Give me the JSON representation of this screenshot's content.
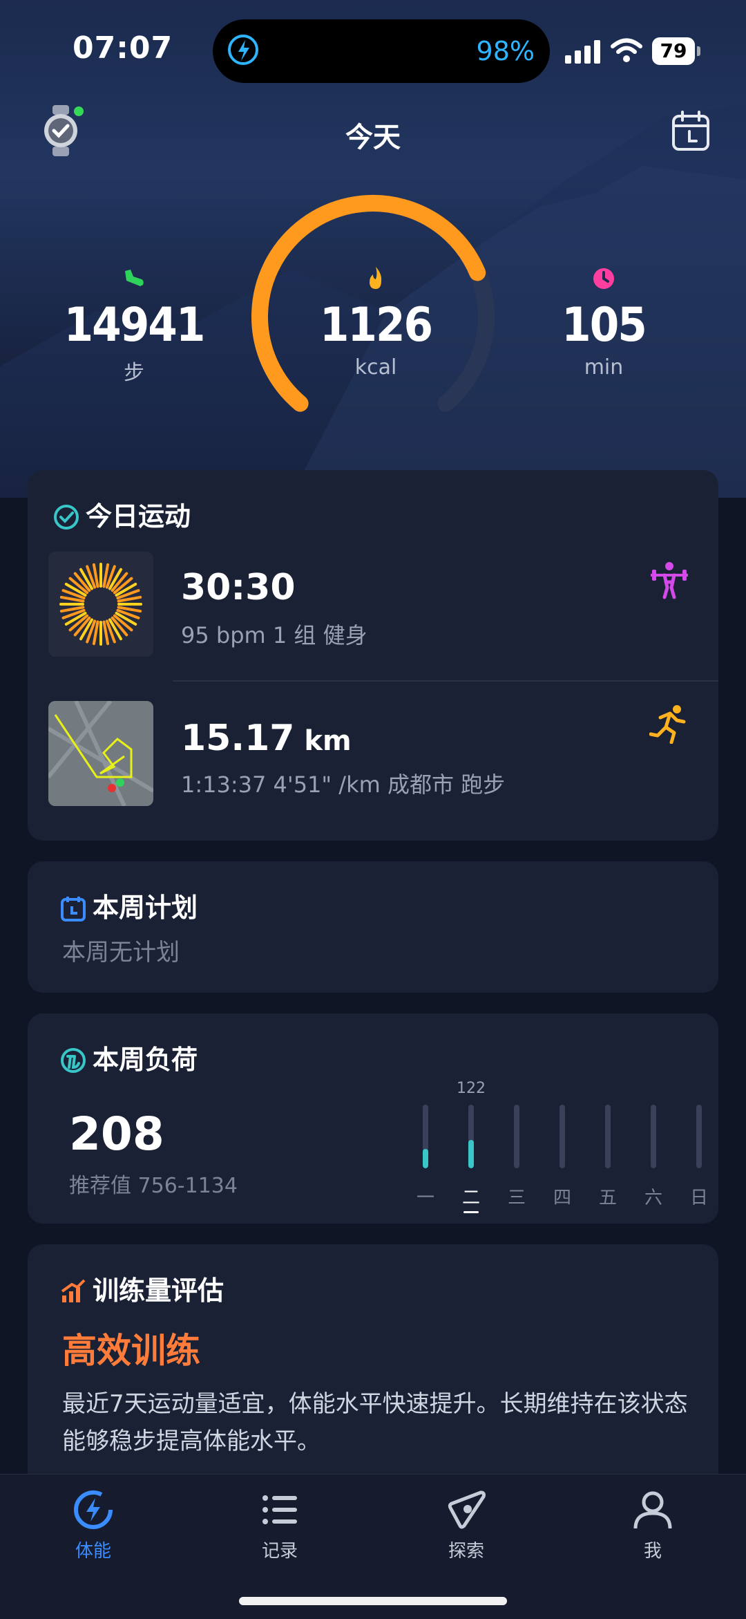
{
  "status_bar": {
    "time": "07:07",
    "battery_percent": "98%",
    "battery_level": "79"
  },
  "header": {
    "title": "今天"
  },
  "summary": {
    "steps": {
      "value": "14941",
      "unit": "步",
      "icon": "shoe-icon",
      "color": "#2fd35c"
    },
    "calories": {
      "value": "1126",
      "unit": "kcal",
      "icon": "flame-icon",
      "color": "#ff9a1f",
      "ring_progress": 0.74
    },
    "minutes": {
      "value": "105",
      "unit": "min",
      "icon": "clock-icon",
      "color": "#ff3fa0"
    }
  },
  "today": {
    "title": "今日运动",
    "activities": [
      {
        "main": "30:30",
        "unit": "",
        "detail": "95 bpm  1 组 健身",
        "icon": "weightlifting-icon"
      },
      {
        "main": "15.17",
        "unit": " km",
        "detail": "1:13:37  4'51\" /km 成都市 跑步",
        "icon": "running-icon"
      }
    ]
  },
  "weekly_plan": {
    "title": "本周计划",
    "empty_text": "本周无计划"
  },
  "weekly_load": {
    "title": "本周负荷",
    "value": "208",
    "recommended": "推荐值 756-1134",
    "days": [
      {
        "label": "一",
        "level": 0.3
      },
      {
        "label": "二",
        "level": 0.45,
        "top_value": "122",
        "selected": true
      },
      {
        "label": "三",
        "level": 0
      },
      {
        "label": "四",
        "level": 0
      },
      {
        "label": "五",
        "level": 0
      },
      {
        "label": "六",
        "level": 0
      },
      {
        "label": "日",
        "level": 0
      }
    ]
  },
  "training_eval": {
    "title": "训练量评估",
    "status": "高效训练",
    "description": "最近7天运动量适宜，体能水平快速提升。长期维持在该状态能够稳步提高体能水平。"
  },
  "tabs": [
    {
      "label": "体能",
      "icon": "fitness-bolt-icon",
      "active": true
    },
    {
      "label": "记录",
      "icon": "list-icon",
      "active": false
    },
    {
      "label": "探索",
      "icon": "compass-icon",
      "active": false
    },
    {
      "label": "我",
      "icon": "person-icon",
      "active": false
    }
  ]
}
